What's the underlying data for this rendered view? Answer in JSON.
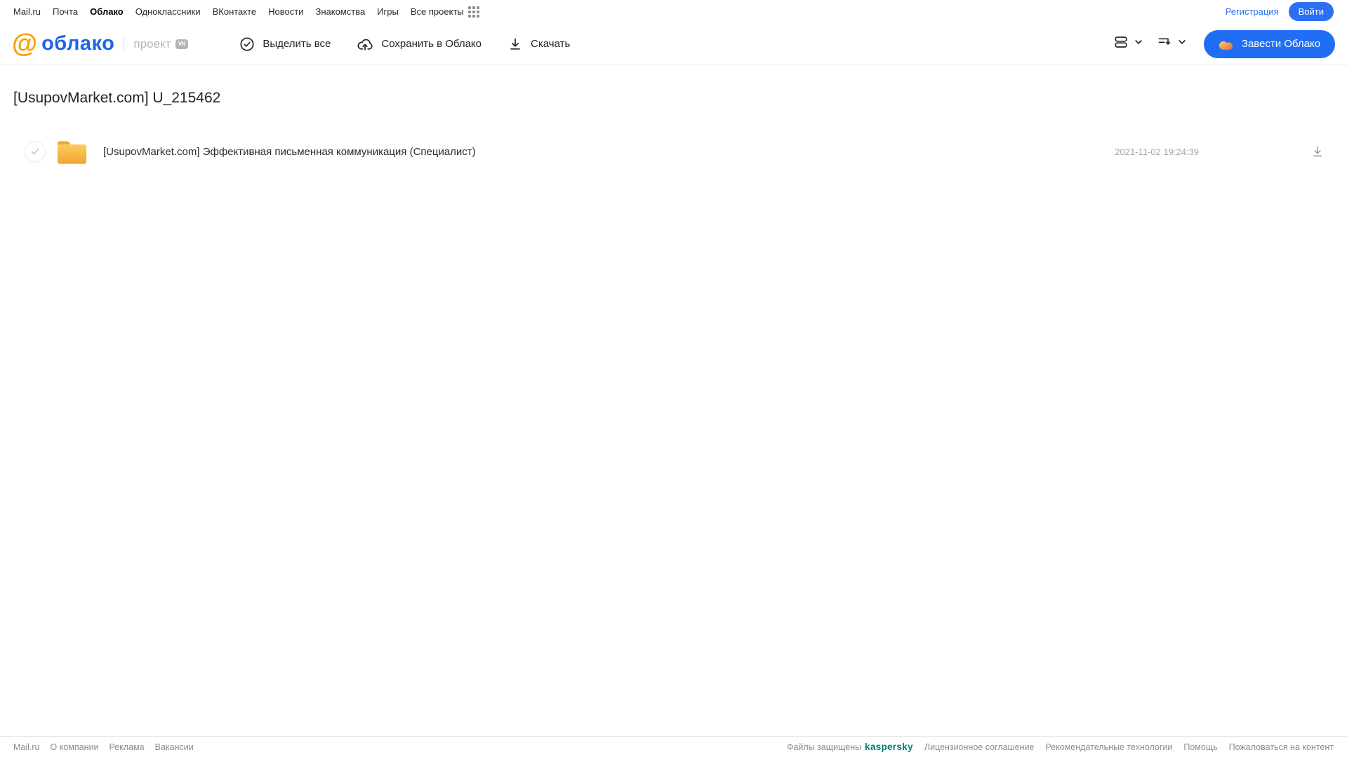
{
  "topnav": {
    "links": [
      "Mail.ru",
      "Почта",
      "Облако",
      "Одноклассники",
      "ВКонтакте",
      "Новости",
      "Знакомства",
      "Игры",
      "Все проекты"
    ],
    "active_link": "Облако",
    "register_label": "Регистрация",
    "login_label": "Войти"
  },
  "header": {
    "logo_at": "@",
    "logo_text": "облако",
    "project_label": "проект",
    "project_badge": "vk",
    "toolbar": {
      "select_all": "Выделить все",
      "save_to_cloud": "Сохранить в Облако",
      "download": "Скачать"
    },
    "create_cloud_label": "Завести Облако"
  },
  "main": {
    "title": "[UsupovMarket.com] U_215462",
    "files": [
      {
        "type": "folder",
        "name": "[UsupovMarket.com] Эффективная письменная коммуникация (Специалист)",
        "modified": "2021-11-02 19:24:39"
      }
    ]
  },
  "footer": {
    "left_links": [
      "Mail.ru",
      "О компании",
      "Реклама",
      "Вакансии"
    ],
    "protected_label": "Файлы защищены",
    "kaspersky_label": "kaspersky",
    "right_links": [
      "Лицензионное соглашение",
      "Рекомендательные технологии",
      "Помощь",
      "Пожаловаться на контент"
    ]
  },
  "colors": {
    "accent_blue": "#1f6ef4",
    "logo_blue": "#1e63e9",
    "logo_orange": "#ff9e00",
    "folder_top": "#ffcb61",
    "folder_bottom": "#f1a530",
    "kaspersky_teal": "#00806f",
    "muted_gray": "#a6a6a6"
  }
}
